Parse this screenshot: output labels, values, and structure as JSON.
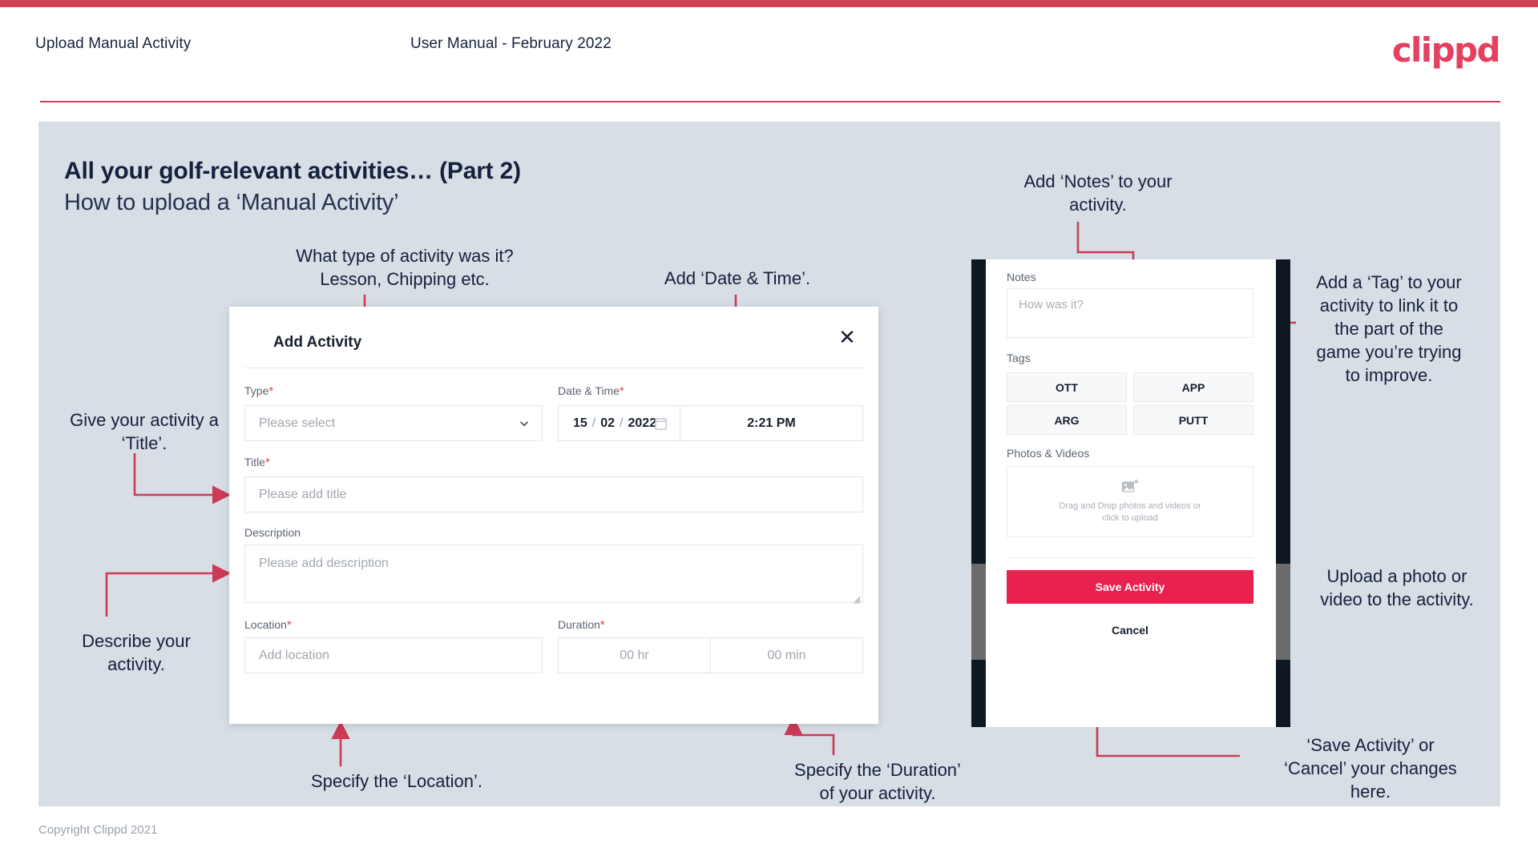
{
  "header": {
    "left_title": "Upload Manual Activity",
    "center_title": "User Manual - February 2022",
    "logo": "clippd"
  },
  "slide": {
    "title": "All your golf-relevant activities… (Part 2)",
    "subtitle": "How to upload a ‘Manual Activity’",
    "copyright": "Copyright Clippd 2021"
  },
  "dialog": {
    "title": "Add Activity",
    "close_icon": "close-icon",
    "fields": {
      "type": {
        "label": "Type",
        "required": "*",
        "placeholder": "Please select"
      },
      "datetime": {
        "label": "Date & Time",
        "required": "*",
        "day": "15",
        "sep1": "/",
        "month": "02",
        "sep2": "/",
        "year": "2022",
        "time": "2:21 PM",
        "calendar_icon": "calendar-icon"
      },
      "title": {
        "label": "Title",
        "required": "*",
        "placeholder": "Please add title"
      },
      "description": {
        "label": "Description",
        "placeholder": "Please add description"
      },
      "location": {
        "label": "Location",
        "required": "*",
        "placeholder": "Add location"
      },
      "duration": {
        "label": "Duration",
        "required": "*",
        "hours": "00 hr",
        "minutes": "00 min"
      }
    }
  },
  "phone": {
    "notes": {
      "label": "Notes",
      "placeholder": "How was it?"
    },
    "tags": {
      "label": "Tags",
      "items": [
        "OTT",
        "APP",
        "ARG",
        "PUTT"
      ]
    },
    "photos": {
      "label": "Photos & Videos",
      "icon": "add-image-icon",
      "dropzone_text": "Drag and Drop photos and videos or\nclick to upload"
    },
    "save_label": "Save Activity",
    "cancel_label": "Cancel"
  },
  "annotations": {
    "type": "What type of activity was it?\nLesson, Chipping etc.",
    "datetime": "Add ‘Date & Time’.",
    "title": "Give your activity a\n‘Title’.",
    "description": "Describe your\nactivity.",
    "location": "Specify the ‘Location’.",
    "duration": "Specify the ‘Duration’\nof your activity.",
    "notes": "Add ‘Notes’ to your\nactivity.",
    "tags": "Add a ‘Tag’ to your\nactivity to link it to\nthe part of the\ngame you’re trying\nto improve.",
    "upload": "Upload a photo or\nvideo to the activity.",
    "save": "‘Save Activity’ or\n‘Cancel’ your changes\nhere."
  },
  "colors": {
    "brand_red": "#e8214e",
    "accent_line": "#d34056",
    "slide_bg": "#d7dee6",
    "ink": "#15213c"
  }
}
